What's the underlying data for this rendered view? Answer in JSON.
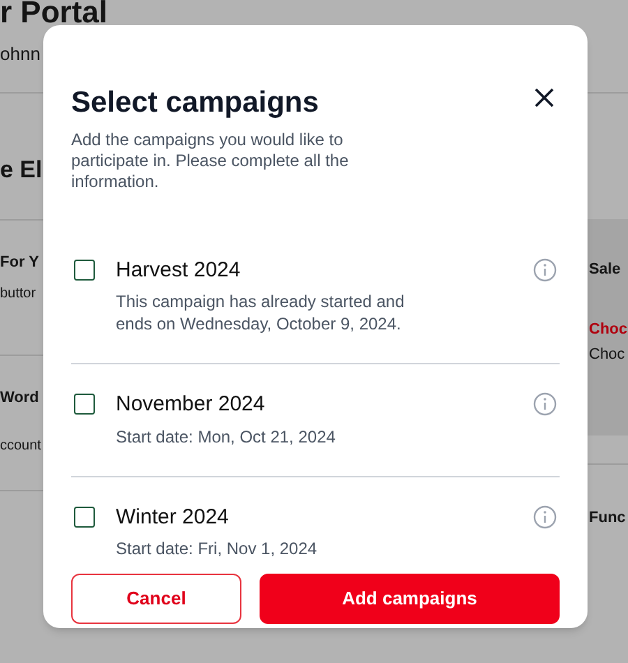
{
  "background": {
    "title": "r Portal",
    "subtitle": "ohnn",
    "heading": "e El",
    "left_cards": [
      {
        "title": "For Y",
        "text": "buttor"
      },
      {
        "title": "Word",
        "text": "ccount"
      }
    ],
    "right_cards": [
      {
        "title": "Sale",
        "link": "Choc",
        "text": "Choc",
        "highlighted": true
      },
      {
        "title": "Func",
        "highlighted": false
      }
    ]
  },
  "dialog": {
    "title": "Select campaigns",
    "description": "Add the campaigns you would like to participate in. Please complete all the information.",
    "campaigns": [
      {
        "name": "Harvest 2024",
        "detail": "This campaign has already started and ends on Wednesday, October 9, 2024.",
        "checked": false
      },
      {
        "name": "November 2024",
        "detail": "Start date: Mon, Oct 21, 2024",
        "checked": false
      },
      {
        "name": "Winter 2024",
        "detail": "Start date: Fri, Nov 1, 2024",
        "checked": false
      }
    ],
    "buttons": {
      "cancel": "Cancel",
      "confirm": "Add campaigns"
    }
  }
}
